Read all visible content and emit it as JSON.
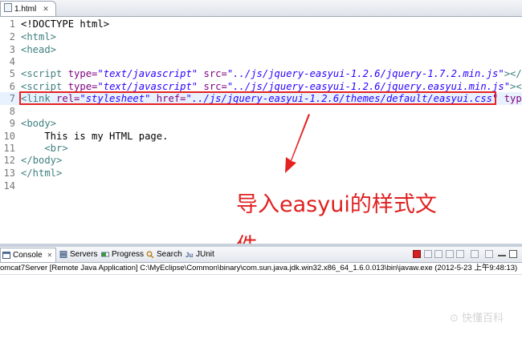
{
  "editor_tab": {
    "filename": "1.html",
    "close_glyph": "✕"
  },
  "gutter": [
    "1",
    "2",
    "3",
    "4",
    "5",
    "6",
    "7",
    "8",
    "9",
    "10",
    "11",
    "12",
    "13",
    "14"
  ],
  "code": {
    "l1": "<!DOCTYPE html>",
    "l2": "<html>",
    "l3": "<head>",
    "l5": {
      "open": "<script",
      "a1": " type=",
      "v1": "\"text/javascript\"",
      "a2": " src=",
      "v2": "\"../js/jquery-easyui-1.2.6/jquery-1.7.2.min.js\"",
      "close": "></scr"
    },
    "l6": {
      "open": "<script",
      "a1": " type=",
      "v1": "\"text/javascript\"",
      "a2": " src=",
      "v2": "\"../js/jquery-easyui-1.2.6/jquery.easyui.min.js\"",
      "close": "></sc"
    },
    "l7": {
      "open": "<link",
      "a1": " rel=",
      "v1": "\"stylesheet\"",
      "a2": " href=",
      "v2": "\"../js/jquery-easyui-1.2.6/themes/default/easyui.css\"",
      "a3": " type="
    },
    "l9": "<body>",
    "l10": "    This is my HTML page.",
    "l11": "    <br>",
    "l12": "</body>",
    "l13": "</html>"
  },
  "annotation": {
    "text": "导入easyui的样式文件",
    "color": "#e02020"
  },
  "console_panel": {
    "tabs": [
      {
        "label": "Console",
        "close": "✕"
      },
      {
        "label": "Servers"
      },
      {
        "label": "Progress"
      },
      {
        "label": "Search"
      },
      {
        "label": "JUnit"
      }
    ],
    "status": "omcat7Server [Remote Java Application] C:\\MyEclipse\\Common\\binary\\com.sun.java.jdk.win32.x86_64_1.6.0.013\\bin\\javaw.exe (2012-5-23 上午9:48:13)"
  },
  "watermark": "⊙ 快懂百科",
  "colors": {
    "highlight_box": "#e52222",
    "tag": "#3f7f7f",
    "attribute": "#7f007f",
    "value": "#2a00ff"
  }
}
